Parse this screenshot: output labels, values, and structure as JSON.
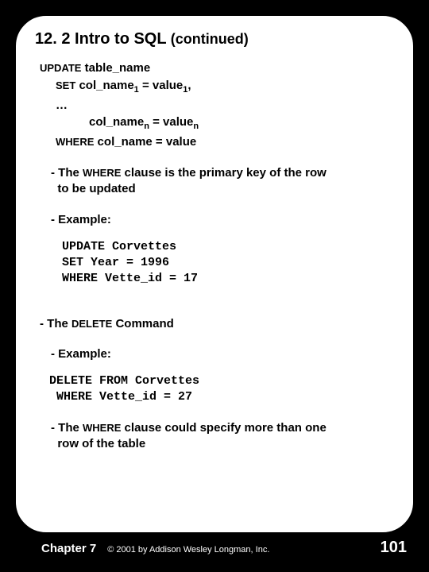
{
  "title_main": "12. 2 Intro to SQL ",
  "title_cont": "(continued)",
  "syntax": {
    "l1_kw": "UPDATE",
    "l1_txt": " table_name",
    "l2_kw": "SET",
    "l2_name": " col_name",
    "l2_sub": "1",
    "l2_eq": " = value",
    "l2_sub2": "1",
    "l2_comma": ",",
    "l3": "…",
    "l4_name": "col_name",
    "l4_sub": "n",
    "l4_eq": " = value",
    "l4_sub2": "n",
    "l5_kw": "WHERE",
    "l5_txt": " col_name = value"
  },
  "bullet_where_pk1": "- The ",
  "bullet_where_pk_kw": "WHERE",
  "bullet_where_pk2": " clause is the primary key of the row",
  "bullet_where_pk3": "to be updated",
  "bullet_example": "- Example:",
  "code_update": "UPDATE Corvettes\nSET Year = 1996\nWHERE Vette_id = 17",
  "bullet_delete1": "- The ",
  "bullet_delete_kw": "DELETE",
  "bullet_delete2": " Command",
  "code_delete": "DELETE FROM Corvettes\n WHERE Vette_id = 27",
  "bullet_multi1": "- The ",
  "bullet_multi_kw": "WHERE",
  "bullet_multi2": " clause could specify more than one",
  "bullet_multi3": "row of the table",
  "footer_chapter": "Chapter 7",
  "footer_copyright": "© 2001 by Addison Wesley Longman, Inc.",
  "footer_pagenum": "101"
}
